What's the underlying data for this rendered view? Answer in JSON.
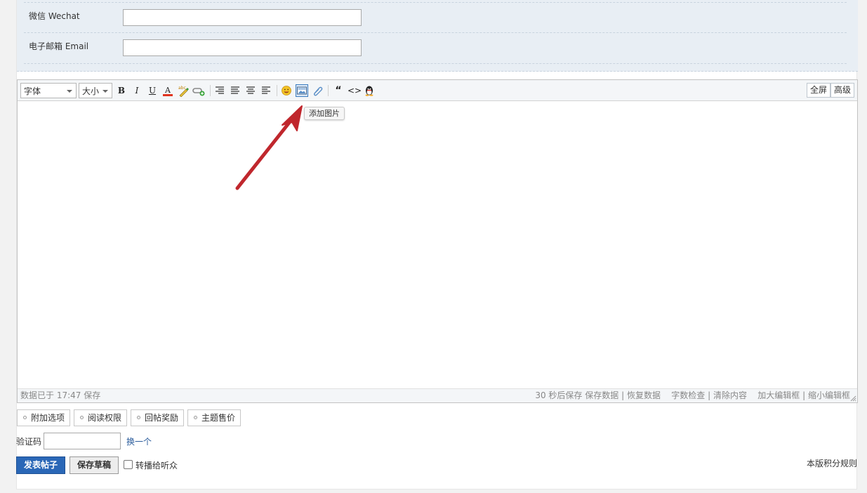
{
  "fields": [
    {
      "label": "微信 Wechat",
      "value": ""
    },
    {
      "label": "电子邮箱 Email",
      "value": ""
    }
  ],
  "toolbar": {
    "font_select": "字体",
    "size_select": "大小",
    "bold": "B",
    "italic": "I",
    "underline": "U",
    "font_color": "A",
    "spellcheck": "abc",
    "quote": "“",
    "code": "<>",
    "fullscreen": "全屏",
    "advanced": "高级"
  },
  "tooltip": "添加图片",
  "status": {
    "saved_at": "数据已于 17:47 保存",
    "autosave": "30 秒后保存",
    "save_data": "保存数据",
    "restore_data": "恢复数据",
    "word_check": "字数检查",
    "clear_content": "清除内容",
    "enlarge": "加大编辑框",
    "shrink": "缩小编辑框",
    "pipe": "|"
  },
  "option_tabs": [
    "附加选项",
    "阅读权限",
    "回帖奖励",
    "主题售价"
  ],
  "captcha": {
    "label": "验证码",
    "value": "",
    "change": "换一个"
  },
  "actions": {
    "post": "发表帖子",
    "draft": "保存草稿",
    "broadcast": "转播给听众",
    "rules": "本版积分规则"
  },
  "colors": {
    "accent": "#2a67b7",
    "arrow": "#c0272d",
    "panel": "#e8eef4"
  }
}
